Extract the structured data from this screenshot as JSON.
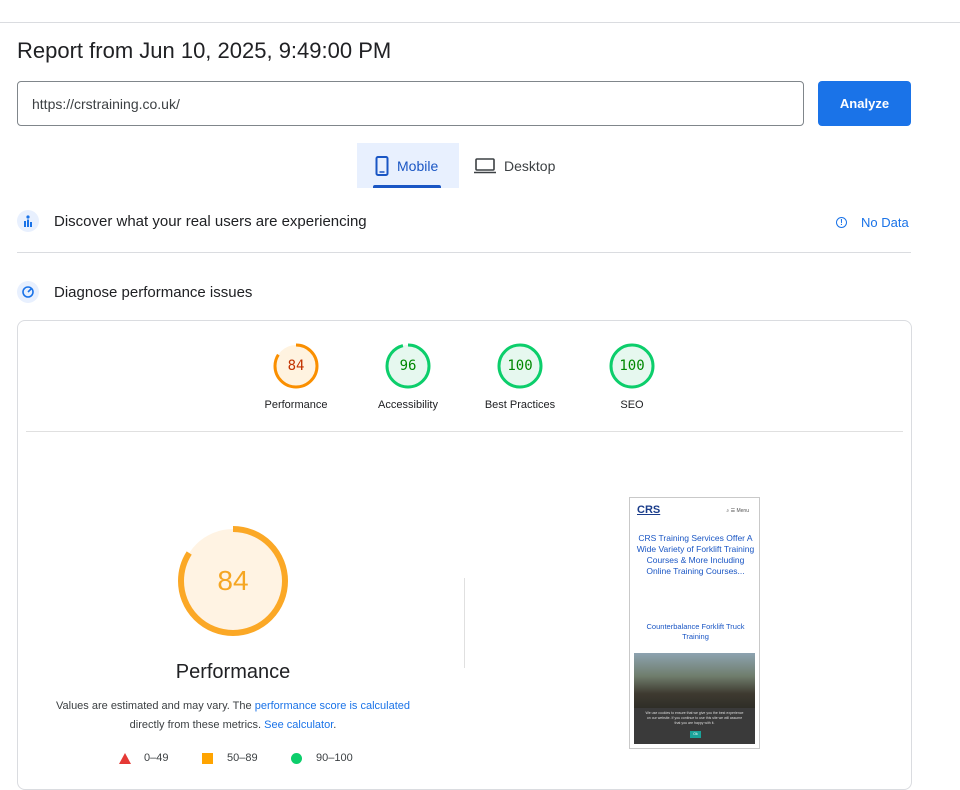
{
  "report": {
    "title": "Report from Jun 10, 2025, 9:49:00 PM"
  },
  "url_input": {
    "value": "https://crstraining.co.uk/"
  },
  "analyze_button": {
    "label": "Analyze"
  },
  "tabs": [
    {
      "label": "Mobile",
      "selected": true
    },
    {
      "label": "Desktop",
      "selected": false
    }
  ],
  "sections": {
    "real_users": {
      "label": "Discover what your real users are experiencing",
      "status": "No Data"
    },
    "diagnose": {
      "label": "Diagnose performance issues"
    }
  },
  "scores": [
    {
      "label": "Performance",
      "value": "84",
      "color": "#fa8f00"
    },
    {
      "label": "Accessibility",
      "value": "96",
      "color": "#0cce6b"
    },
    {
      "label": "Best Practices",
      "value": "100",
      "color": "#0cce6b"
    },
    {
      "label": "SEO",
      "value": "100",
      "color": "#0cce6b"
    }
  ],
  "performance": {
    "score": "84",
    "label": "Performance",
    "note_prefix": "Values are estimated and may vary. The ",
    "note_link1": "performance score is calculated",
    "note_middle": " directly from these metrics. ",
    "note_link2": "See calculator",
    "note_suffix": "."
  },
  "legend": [
    {
      "range": "0–49",
      "color": "#e53935",
      "shape": "triangle"
    },
    {
      "range": "50–89",
      "color": "#ffa400",
      "shape": "square"
    },
    {
      "range": "90–100",
      "color": "#0cce6b",
      "shape": "circle"
    }
  ],
  "screenshot": {
    "logo": "CRS",
    "menu": "⌕   ☰ Menu",
    "headline": "CRS Training Services Offer A Wide Variety of Forklift Training Courses & More Including Online Training Courses...",
    "subheading": "Counterbalance Forklift Truck Training",
    "cookie_text": "We use cookies to ensure that we give you the best experience on our website. If you continue to use this site we will assume that you are happy with it.",
    "cookie_ok": "Ok"
  },
  "colors": {
    "accent": "#1a73e8",
    "average": "#fa8f00",
    "pass": "#0cce6b"
  }
}
